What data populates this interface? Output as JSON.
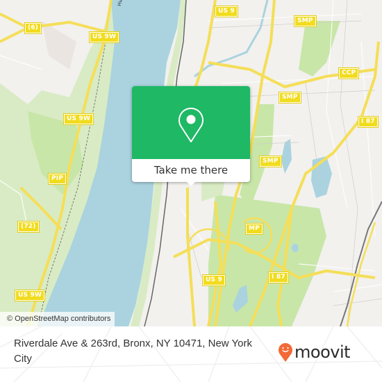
{
  "map": {
    "river_label": "Hudson River",
    "road_shields": [
      {
        "id": "route-6",
        "label": "(6)"
      },
      {
        "id": "us-9w-top",
        "label": "US 9W"
      },
      {
        "id": "us-9w-mid",
        "label": "US 9W"
      },
      {
        "id": "pip",
        "label": "PIP"
      },
      {
        "id": "route-72",
        "label": "(72)"
      },
      {
        "id": "us-9w-bottom",
        "label": "US 9W"
      },
      {
        "id": "us-9-top",
        "label": "US 9"
      },
      {
        "id": "smp-top",
        "label": "SMP"
      },
      {
        "id": "ccp",
        "label": "CCP"
      },
      {
        "id": "smp-mid",
        "label": "SMP"
      },
      {
        "id": "i87-top",
        "label": "I 87"
      },
      {
        "id": "smp-bottom",
        "label": "SMP"
      },
      {
        "id": "mp",
        "label": "MP"
      },
      {
        "id": "us-9-bottom",
        "label": "US 9"
      },
      {
        "id": "i87-bottom",
        "label": "I 87"
      }
    ],
    "colors": {
      "water": "#aad3df",
      "park": "#c8e6a8",
      "land": "#f2f1ee",
      "road": "#f5de58",
      "shield": "#f1dc1e",
      "popup_green": "#1fb865",
      "moovit_orange": "#f26a36"
    }
  },
  "popup": {
    "button_label": "Take me there",
    "icon": "location-pin-icon"
  },
  "attribution": "© OpenStreetMap contributors",
  "footer": {
    "address": "Riverdale Ave & 263rd, Bronx, NY 10471, New York City",
    "brand": "moovit"
  }
}
